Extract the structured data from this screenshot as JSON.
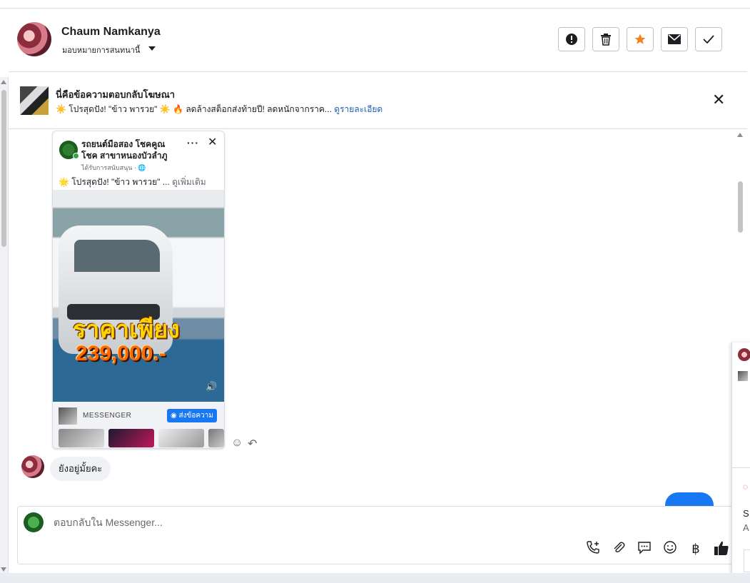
{
  "header": {
    "contact_name": "Chaum Namkanya",
    "assign_label": "มอบหมายการสนทนานี้",
    "actions": [
      "spam",
      "delete",
      "star",
      "mark-unread",
      "done"
    ]
  },
  "ad_reply": {
    "title": "นี่คือข้อความตอบกลับโฆษณา",
    "snippet": "☀️ โปรสุดปัง! \"ข้าว พารวย\" ☀️ 🔥 ลดล้างสต็อกส่งท้ายปี! ลดหนักจากราค...",
    "details_link": "ดูรายละเอียด"
  },
  "ad_card": {
    "page_name": "รถยนต์มือสอง โชคคูณ โชค สาขาหนองบัวลำภู",
    "sponsored": "ได้รับการสนับสนุน · 🌐",
    "more_menu": "···",
    "close": "✕",
    "text": "🌟 โปรสุดปัง! \"ข้าว พารวย\" ...",
    "see_more": "ดูเพิ่มเติม",
    "price_label": "ราคาเพียง",
    "price_value": "239,000.-",
    "footer_label": "MESSENGER",
    "footer_button": "ส่งข้อความ"
  },
  "messages": {
    "incoming_text": "ยังอยู่มั้ยคะ"
  },
  "composer": {
    "placeholder": "ตอบกลับใน Messenger...",
    "currency_symbol": "฿"
  },
  "side_panel": {
    "letter_s": "S",
    "letter_a": "A"
  },
  "colors": {
    "accent_blue": "#1877f2",
    "star_orange": "#f5821f",
    "link_blue": "#1a5fb4"
  }
}
